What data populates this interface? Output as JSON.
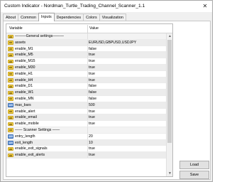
{
  "window": {
    "title": "Custom Indicator - Nordman_Turtle_Trading_Channel_Scanner_1.1",
    "close_glyph": "✕"
  },
  "tabs": [
    {
      "label": "About",
      "active": false
    },
    {
      "label": "Common",
      "active": false
    },
    {
      "label": "Inputs",
      "active": true
    },
    {
      "label": "Dependencies",
      "active": false
    },
    {
      "label": "Colors",
      "active": false
    },
    {
      "label": "Visualization",
      "active": false
    }
  ],
  "grid": {
    "headers": {
      "variable": "Variable",
      "value": "Value"
    },
    "rows": [
      {
        "icon": "ab",
        "name": "———General settings———",
        "value": "",
        "section": true
      },
      {
        "icon": "ab",
        "name": "assets",
        "value": "EURUSD,GBPUSD,USDJPY"
      },
      {
        "icon": "ab",
        "name": "enable_M1",
        "value": "false"
      },
      {
        "icon": "ab",
        "name": "enable_M5",
        "value": "true"
      },
      {
        "icon": "ab",
        "name": "enable_M15",
        "value": "true"
      },
      {
        "icon": "ab",
        "name": "enable_M30",
        "value": "true"
      },
      {
        "icon": "ab",
        "name": "enable_H1",
        "value": "true"
      },
      {
        "icon": "ab",
        "name": "enable_H4",
        "value": "true"
      },
      {
        "icon": "ab",
        "name": "enable_D1",
        "value": "false"
      },
      {
        "icon": "ab",
        "name": "enable_W1",
        "value": "false"
      },
      {
        "icon": "ab",
        "name": "enable_MN",
        "value": "false"
      },
      {
        "icon": "num",
        "name": "max_bars",
        "value": "500"
      },
      {
        "icon": "ab",
        "name": "enable_alert",
        "value": "true"
      },
      {
        "icon": "ab",
        "name": "enable_email",
        "value": "true"
      },
      {
        "icon": "ab",
        "name": "enable_mobile",
        "value": "true"
      },
      {
        "icon": "ab",
        "name": "—— Scanner Settings ——",
        "value": "",
        "section": true
      },
      {
        "icon": "num",
        "name": "entry_length",
        "value": "20"
      },
      {
        "icon": "num",
        "name": "exit_length",
        "value": "10"
      },
      {
        "icon": "ab",
        "name": "enable_exit_signals",
        "value": "true"
      },
      {
        "icon": "ab",
        "name": "enable_exit_alerts",
        "value": "true"
      }
    ],
    "icon_labels": {
      "ab": "ab",
      "num": "123"
    }
  },
  "buttons": {
    "load": "Load",
    "save": "Save"
  },
  "scrollbar": {
    "up": "▲",
    "down": "▼"
  }
}
